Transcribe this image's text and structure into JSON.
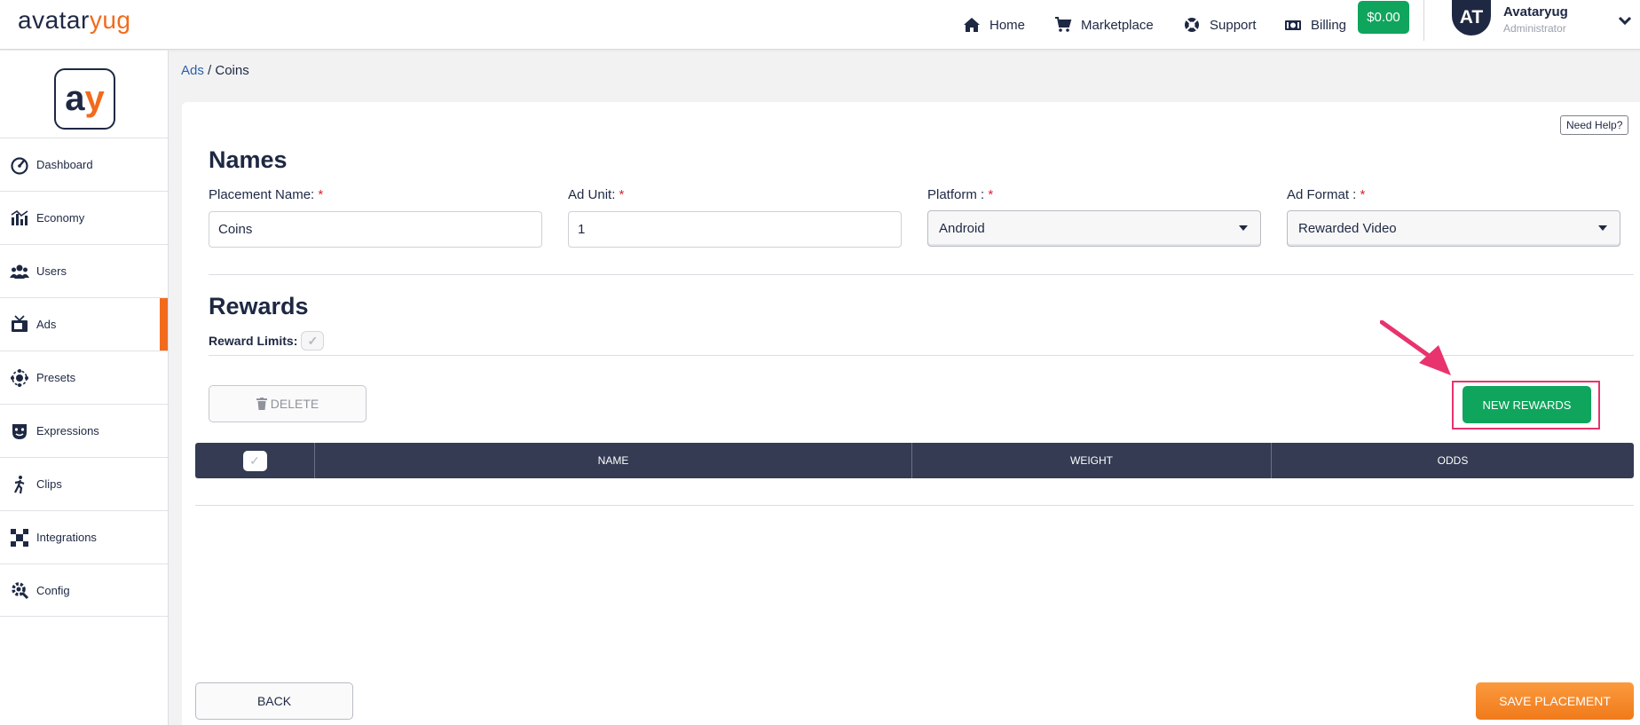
{
  "brand": {
    "logo_part1": "avatar",
    "logo_part2": "yug",
    "mark_a": "a",
    "mark_y": "y",
    "accent_color": "#f26b1d",
    "primary_color": "#1e2843",
    "success_color": "#0fa55d"
  },
  "topnav": {
    "items": [
      {
        "label": "Home",
        "icon": "home-icon"
      },
      {
        "label": "Marketplace",
        "icon": "cart-icon"
      },
      {
        "label": "Support",
        "icon": "lifebuoy-icon"
      },
      {
        "label": "Billing",
        "icon": "money-icon"
      }
    ],
    "balance": "$0.00"
  },
  "user": {
    "initials": "AT",
    "name": "Avataryug",
    "role": "Administrator"
  },
  "sidebar": {
    "items": [
      {
        "label": "Dashboard",
        "icon": "dashboard-icon"
      },
      {
        "label": "Economy",
        "icon": "economy-icon"
      },
      {
        "label": "Users",
        "icon": "users-icon"
      },
      {
        "label": "Ads",
        "icon": "ads-icon",
        "active": true
      },
      {
        "label": "Presets",
        "icon": "presets-icon"
      },
      {
        "label": "Expressions",
        "icon": "expressions-icon"
      },
      {
        "label": "Clips",
        "icon": "clips-icon"
      },
      {
        "label": "Integrations",
        "icon": "integrations-icon"
      },
      {
        "label": "Config",
        "icon": "config-icon"
      }
    ]
  },
  "breadcrumb": {
    "parent": "Ads",
    "separator": " / ",
    "current": "Coins"
  },
  "help_label": "Need Help?",
  "names": {
    "title": "Names",
    "placement_name": {
      "label": "Placement Name:",
      "required": "*",
      "value": "Coins"
    },
    "ad_unit": {
      "label": "Ad Unit:",
      "required": "*",
      "value": "1"
    },
    "platform": {
      "label": "Platform :",
      "required": "*",
      "value": "Android"
    },
    "ad_format": {
      "label": "Ad Format :",
      "required": "*",
      "value": "Rewarded Video"
    }
  },
  "rewards": {
    "title": "Rewards",
    "limits_label": "Reward Limits:",
    "limits_checked": true,
    "delete_label": "DELETE",
    "new_label": "NEW REWARDS",
    "columns": [
      "NAME",
      "WEIGHT",
      "ODDS"
    ],
    "rows": []
  },
  "footer": {
    "back_label": "BACK",
    "save_label": "SAVE PLACEMENT"
  },
  "checkmark": "✓"
}
